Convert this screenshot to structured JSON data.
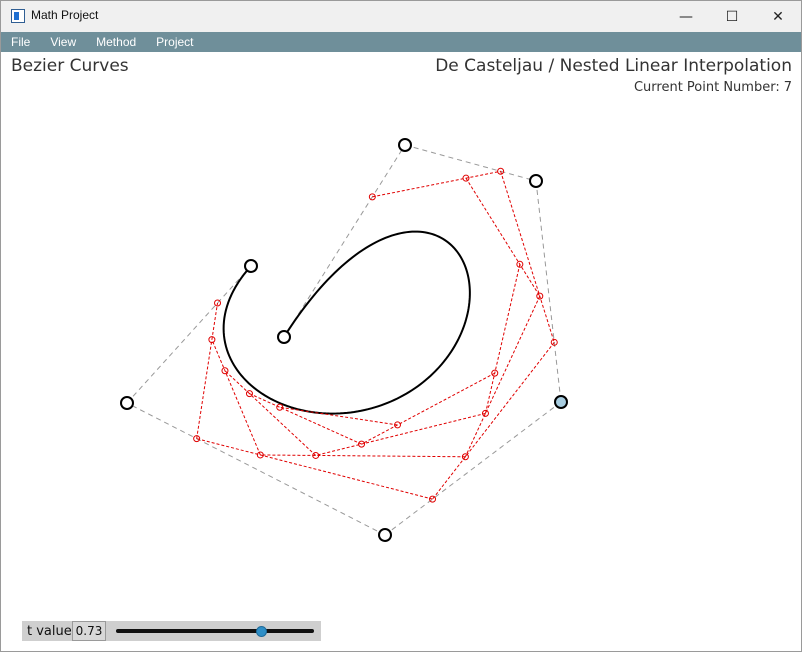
{
  "window": {
    "title": "Math Project",
    "minimize_glyph": "—",
    "maximize_glyph": "☐",
    "close_glyph": "✕"
  },
  "menu": {
    "items": [
      {
        "label": "File"
      },
      {
        "label": "View"
      },
      {
        "label": "Method"
      },
      {
        "label": "Project"
      }
    ]
  },
  "header": {
    "left_title": "Bezier Curves",
    "right_title": "De Casteljau / Nested Linear Interpolation",
    "point_count_label": "Current Point Number:",
    "point_count_value": "7"
  },
  "controls": {
    "t_label": "t value",
    "t_value": "0.73",
    "t_fraction": 0.73
  },
  "colors": {
    "menubar": "#6f8f9a",
    "construction_lines": "#e00000",
    "control_polygon": "#999999",
    "selected_point": "#a8cde0",
    "curve": "#000000"
  },
  "icons": {
    "app": "app-window-icon",
    "minimize": "minimize-icon",
    "maximize": "maximize-icon",
    "close": "close-icon"
  }
}
